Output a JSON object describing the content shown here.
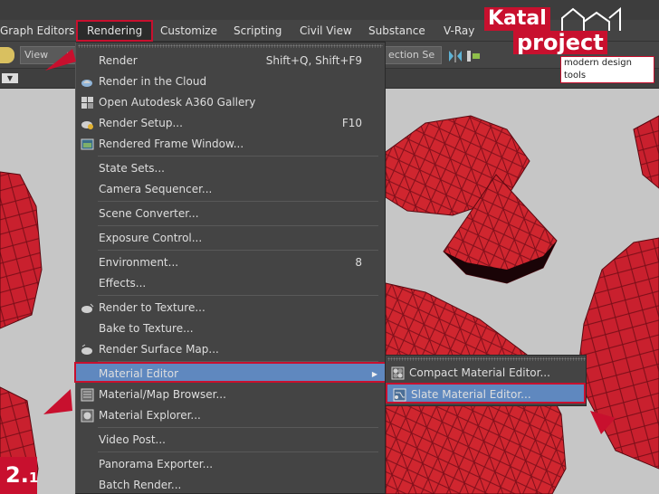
{
  "menubar": {
    "items": [
      {
        "label": "Graph Editors"
      },
      {
        "label": "Rendering"
      },
      {
        "label": "Customize"
      },
      {
        "label": "Scripting"
      },
      {
        "label": "Civil View"
      },
      {
        "label": "Substance"
      },
      {
        "label": "V-Ray"
      }
    ]
  },
  "toolbar": {
    "view_combo": "View",
    "selection_combo": "ection Se"
  },
  "rendering_menu": {
    "items": [
      {
        "label": "Render",
        "shortcut": "Shift+Q, Shift+F9",
        "icon": "none"
      },
      {
        "label": "Render in the Cloud",
        "shortcut": "",
        "icon": "cloud-teapot-icon"
      },
      {
        "label": "Open Autodesk A360 Gallery",
        "shortcut": "",
        "icon": "gallery-grid-icon"
      },
      {
        "label": "Render Setup...",
        "shortcut": "F10",
        "icon": "teapot-gear-icon"
      },
      {
        "label": "Rendered Frame Window...",
        "shortcut": "",
        "icon": "frame-window-icon"
      },
      {
        "label": "State Sets...",
        "shortcut": "",
        "icon": "none"
      },
      {
        "label": "Camera Sequencer...",
        "shortcut": "",
        "icon": "none"
      },
      {
        "label": "Scene Converter...",
        "shortcut": "",
        "icon": "none"
      },
      {
        "label": "Exposure Control...",
        "shortcut": "",
        "icon": "none"
      },
      {
        "label": "Environment...",
        "shortcut": "8",
        "icon": "none"
      },
      {
        "label": "Effects...",
        "shortcut": "",
        "icon": "none"
      },
      {
        "label": "Render to Texture...",
        "shortcut": "",
        "icon": "teapot-texture-icon"
      },
      {
        "label": "Bake to Texture...",
        "shortcut": "",
        "icon": "none"
      },
      {
        "label": "Render Surface Map...",
        "shortcut": "",
        "icon": "teapot-map-icon"
      },
      {
        "label": "Material Editor",
        "shortcut": "",
        "icon": "none"
      },
      {
        "label": "Material/Map Browser...",
        "shortcut": "",
        "icon": "material-browser-icon"
      },
      {
        "label": "Material Explorer...",
        "shortcut": "",
        "icon": "material-explorer-icon"
      },
      {
        "label": "Video Post...",
        "shortcut": "",
        "icon": "none"
      },
      {
        "label": "Panorama Exporter...",
        "shortcut": "",
        "icon": "none"
      },
      {
        "label": "Batch Render...",
        "shortcut": "",
        "icon": "none"
      }
    ]
  },
  "material_submenu": {
    "items": [
      {
        "label": "Compact Material Editor...",
        "icon": "compact-material-icon"
      },
      {
        "label": "Slate Material Editor...",
        "icon": "slate-material-icon"
      }
    ]
  },
  "logo": {
    "line1": "Katal",
    "line2": "project",
    "tagline": "modern design tools"
  },
  "step_badge": {
    "major": "2.",
    "minor": "1"
  },
  "colors": {
    "accent": "#c8102e",
    "highlight": "#5f88bf",
    "menu_bg": "#444444",
    "gem": "#c9202e"
  }
}
